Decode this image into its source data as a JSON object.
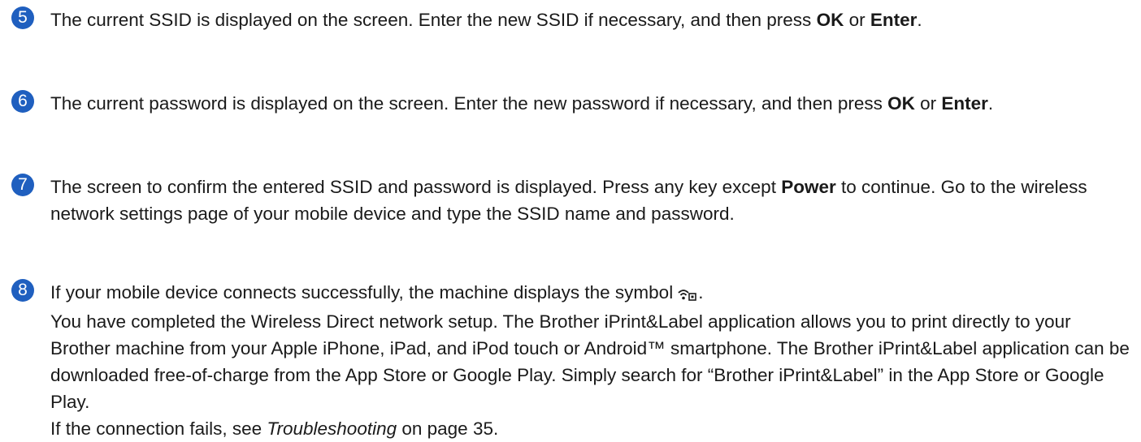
{
  "steps": [
    {
      "number": "5",
      "text_a": "The current SSID is displayed on the screen. Enter the new SSID if necessary, and then press ",
      "key_ok": "OK",
      "text_or": " or ",
      "key_enter": "Enter",
      "text_end": "."
    },
    {
      "number": "6",
      "text_a": "The current password is displayed on the screen. Enter the new password if necessary, and then press ",
      "key_ok": "OK",
      "text_or": " or ",
      "key_enter": "Enter",
      "text_end": "."
    },
    {
      "number": "7",
      "text_a": "The screen to confirm the entered SSID and password is displayed. Press any key except ",
      "key_power": "Power",
      "text_b": " to continue. Go to the wireless network settings page of your mobile device and type the SSID name and password."
    },
    {
      "number": "8",
      "line1": "If your mobile device connects successfully, the machine displays the symbol",
      "line1_end": ".",
      "symbol_icon": "wireless-direct-icon",
      "paragraph": "You have completed the Wireless Direct network setup. The Brother iPrint&Label application allows you to print directly to your Brother machine from your Apple iPhone, iPad, and iPod touch or Android™ smartphone. The Brother iPrint&Label application can be downloaded free-of-charge from the App Store or Google Play. Simply search for “Brother iPrint&Label” in the App Store or Google Play.",
      "fail_prefix": "If the connection fails, see ",
      "fail_link": "Troubleshooting",
      "fail_suffix": " on page 35."
    }
  ],
  "colors": {
    "badge": "#1f5fbf",
    "text": "#1a1a1a"
  }
}
